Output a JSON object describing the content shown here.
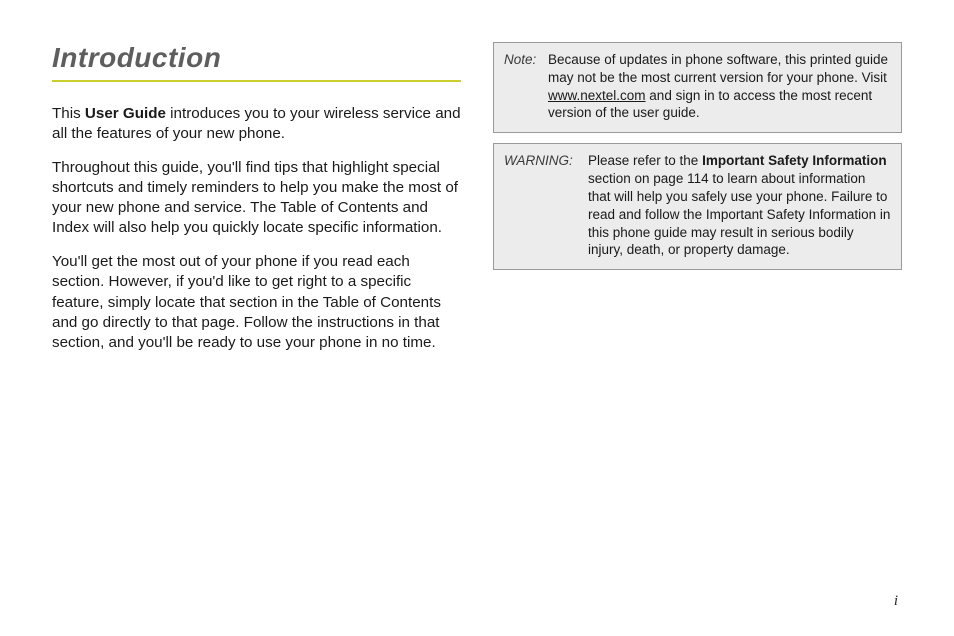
{
  "heading": "Introduction",
  "left": {
    "p1_prefix": "This ",
    "p1_bold": "User Guide",
    "p1_suffix": " introduces you to your wireless service and all the features of your new phone.",
    "p2": "Throughout this guide, you'll find tips that highlight special shortcuts and timely reminders to help you make the most of your new phone and service. The Table of Contents and Index will also help you quickly locate specific information.",
    "p3": "You'll get the most out of your phone if you read each section. However, if you'd like to get right to a specific feature, simply locate that section in the Table of Contents and go directly to that page. Follow the instructions in that section, and you'll be ready to use your phone in no time."
  },
  "note": {
    "label": "Note:",
    "pre": "Because of updates in phone software, this printed guide may not be the most current version for your phone. Visit ",
    "link": "www.nextel.com",
    "post": " and sign in to access the most recent version of the user guide."
  },
  "warning": {
    "label": "WARNING:",
    "pre": "Please refer to the ",
    "bold": "Important Safety Information",
    "post": " section on page 114 to learn about information that will help you safely use your phone. Failure to read and follow the Important Safety Information in this phone guide may result in serious bodily injury, death, or property damage."
  },
  "page_number": "i"
}
